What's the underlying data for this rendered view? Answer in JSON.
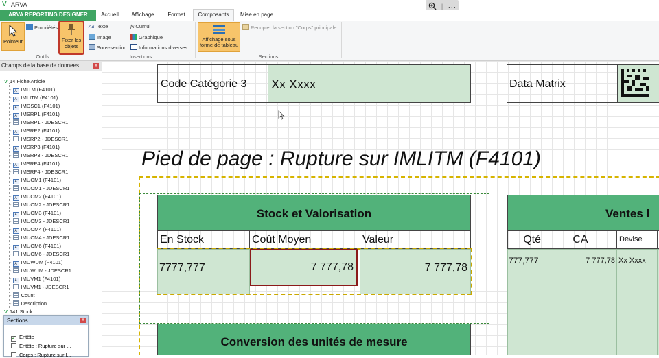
{
  "window": {
    "title": "ARVA"
  },
  "zoom": {
    "zoom_icon": "zoom-in-icon",
    "more_icon": "ellipsis-icon",
    "more_label": "···"
  },
  "ribbon": {
    "app_button": "ARVA REPORTING DESIGNER",
    "tabs": [
      {
        "label": "Accueil"
      },
      {
        "label": "Affichage"
      },
      {
        "label": "Format"
      },
      {
        "label": "Composants"
      },
      {
        "label": "Mise en page"
      }
    ],
    "active_tab": "Composants",
    "outils": {
      "group_label": "Outils",
      "pointeur": "Pointeur",
      "proprietes": "Propriétés",
      "fixer": "Fixer les objets"
    },
    "insertions": {
      "group_label": "Insertions",
      "texte": "Texte",
      "image": "Image",
      "sous_section": "Sous-section",
      "cumul": "Cumul",
      "graphique": "Graphique",
      "informations": "Informations diverses"
    },
    "sections": {
      "group_label": "Sections",
      "affichage_tableau": "Affichage sous forme de tableau",
      "recopier": "Recopier la section \"Corps\" principale"
    }
  },
  "fields_panel": {
    "title": "Champs de la base de donnees",
    "root": "14 Fiche Article",
    "items": [
      "IMITM (F4101)",
      "IMLITM (F4101)",
      "IMDSC1 (F4101)",
      "IMSRP1 (F4101)",
      "IMSRP1 - JDESCR1",
      "IMSRP2 (F4101)",
      "IMSRP2 - JDESCR1",
      "IMSRP3 (F4101)",
      "IMSRP3 - JDESCR1",
      "IMSRP4 (F4101)",
      "IMSRP4 - JDESCR1",
      "IMUOM1 (F4101)",
      "IMUOM1 - JDESCR1",
      "IMUOM2 (F4101)",
      "IMUOM2 - JDESCR1",
      "IMUOM3 (F4101)",
      "IMUOM3 - JDESCR1",
      "IMUOM4 (F4101)",
      "IMUOM4 - JDESCR1",
      "IMUOM6 (F4101)",
      "IMUOM6 - JDESCR1",
      "IMUWUM (F4101)",
      "IMUWUM - JDESCR1",
      "IMUVM1 (F4101)",
      "IMUVM1 - JDESCR1",
      "Count",
      "Description"
    ],
    "next_root": "141 Stock"
  },
  "sections_panel": {
    "title": "Sections",
    "items": [
      {
        "label": "Entête",
        "checked": true
      },
      {
        "label": "Entête : Rupture sur ...",
        "checked": false
      },
      {
        "label": "Corps : Rupture sur I...",
        "checked": false
      }
    ]
  },
  "canvas": {
    "top_row": {
      "code_categorie_label": "Code Catégorie 3",
      "code_categorie_value": "Xx Xxxx",
      "data_matrix_label": "Data Matrix"
    },
    "footer_heading": "Pied de page : Rupture sur IMLITM (F4101)",
    "stock_table": {
      "title": "Stock et Valorisation",
      "columns": [
        "En Stock",
        "Coût Moyen",
        "Valeur"
      ],
      "values": [
        "7777,777",
        "7 777,78",
        "7 777,78"
      ]
    },
    "ventes_table": {
      "title": "Ventes l",
      "columns": [
        "Qté",
        "CA",
        "Devise"
      ],
      "values": [
        "777,777",
        "7 777,78",
        "Xx Xxxx"
      ]
    },
    "conversion_title": "Conversion des unités de mesure"
  },
  "colors": {
    "accent_green": "#3fa563",
    "header_green": "#52b27a",
    "field_green": "#cfe6d2",
    "selection_red": "#8b1a1a"
  }
}
